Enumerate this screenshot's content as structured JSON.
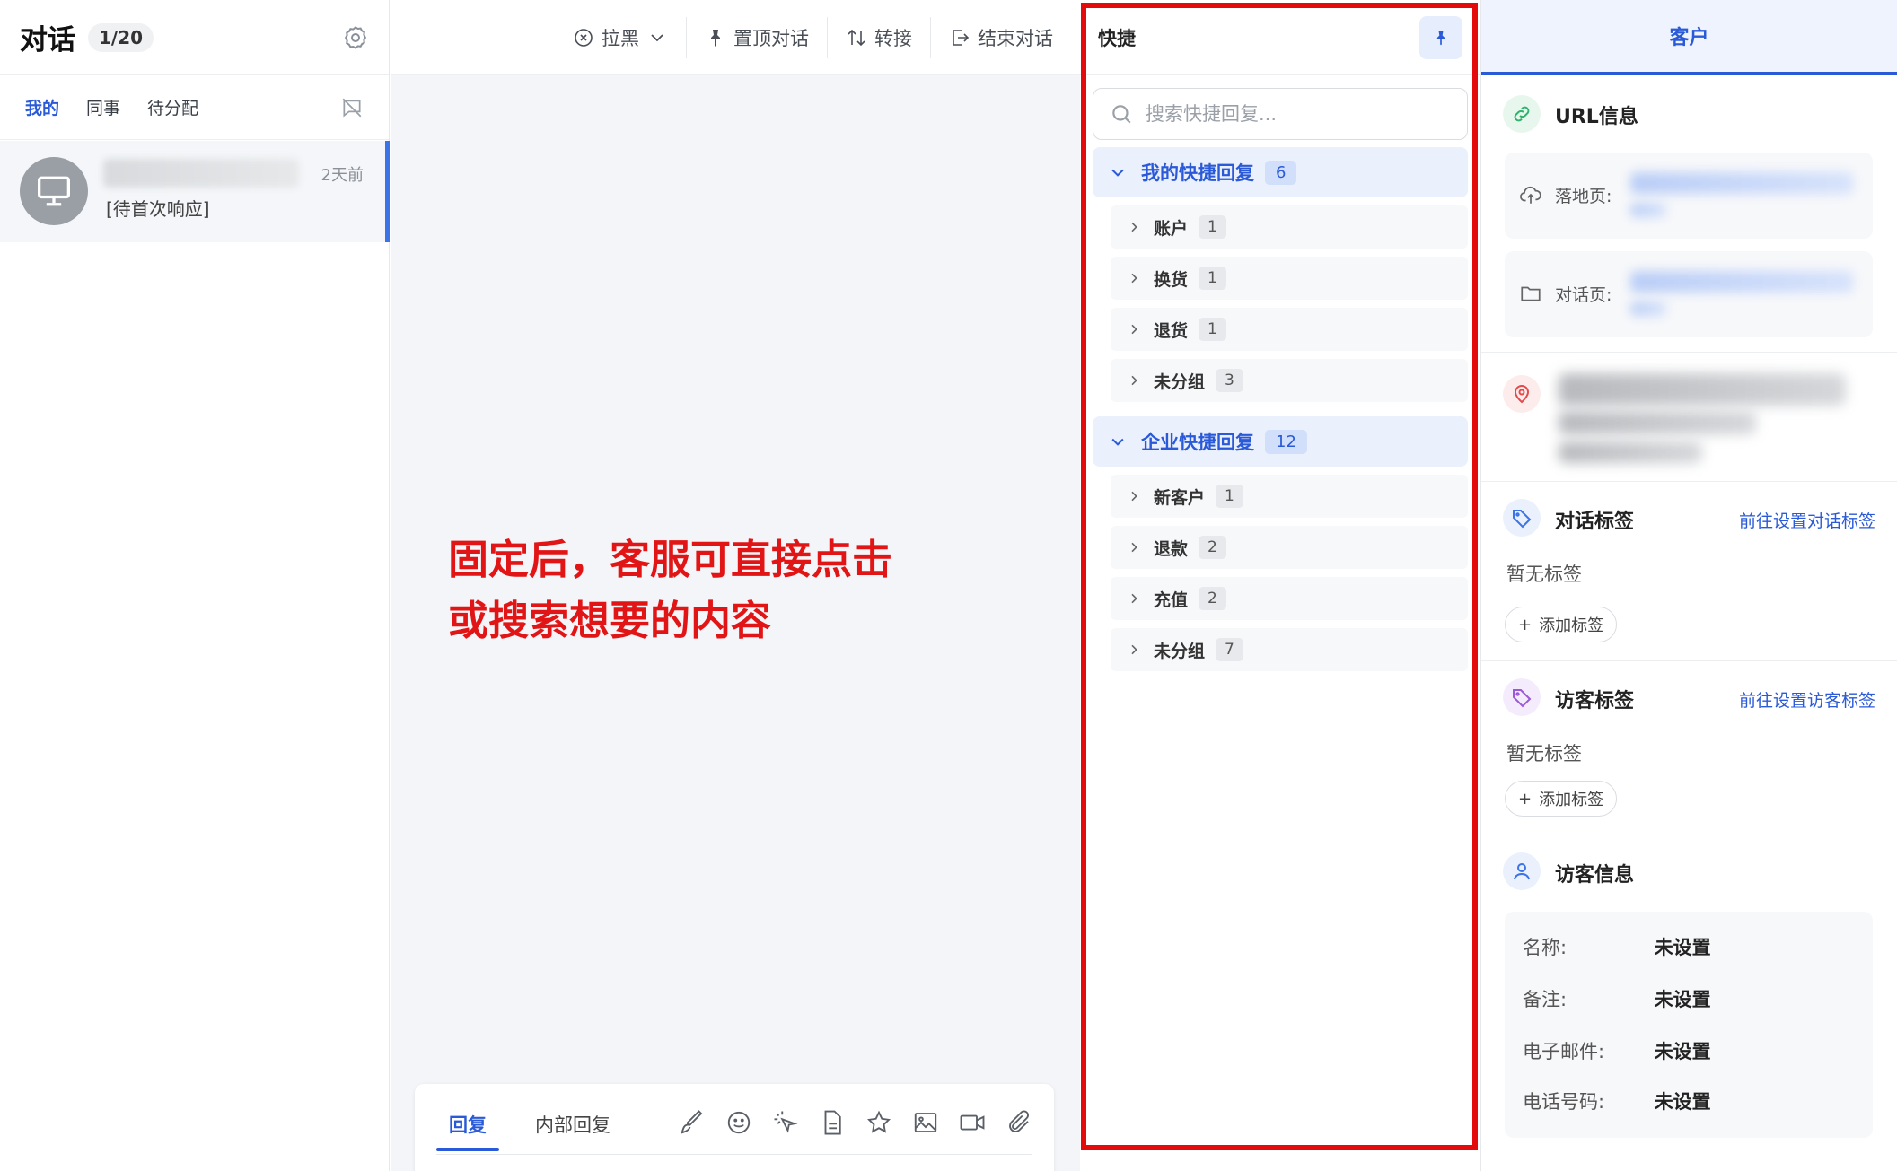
{
  "left": {
    "title": "对话",
    "count": "1/20",
    "tabs": [
      "我的",
      "同事",
      "待分配"
    ],
    "conversation": {
      "time": "2天前",
      "message": "[待首次响应]"
    }
  },
  "toolbar": {
    "blacklist": "拉黑",
    "pin": "置顶对话",
    "transfer": "转接",
    "end": "结束对话"
  },
  "annotation": {
    "line1": "固定后，客服可直接点击",
    "line2": "或搜索想要的内容"
  },
  "composer": {
    "tab_reply": "回复",
    "tab_internal": "内部回复"
  },
  "quick": {
    "title": "快捷",
    "search_placeholder": "搜索快捷回复...",
    "groups": [
      {
        "label": "我的快捷回复",
        "count": "6",
        "items": [
          {
            "label": "账户",
            "count": "1"
          },
          {
            "label": "换货",
            "count": "1"
          },
          {
            "label": "退货",
            "count": "1"
          },
          {
            "label": "未分组",
            "count": "3"
          }
        ]
      },
      {
        "label": "企业快捷回复",
        "count": "12",
        "items": [
          {
            "label": "新客户",
            "count": "1"
          },
          {
            "label": "退款",
            "count": "2"
          },
          {
            "label": "充值",
            "count": "2"
          },
          {
            "label": "未分组",
            "count": "7"
          }
        ]
      }
    ]
  },
  "right": {
    "tab": "客户",
    "url_section": {
      "title": "URL信息",
      "landing": "落地页:",
      "dialog": "对话页:"
    },
    "conv_tags": {
      "title": "对话标签",
      "link": "前往设置对话标签",
      "empty": "暂无标签",
      "add": "添加标签"
    },
    "visitor_tags": {
      "title": "访客标签",
      "link": "前往设置访客标签",
      "empty": "暂无标签",
      "add": "添加标签"
    },
    "visitor_info": {
      "title": "访客信息",
      "rows": [
        {
          "key": "名称:",
          "value": "未设置"
        },
        {
          "key": "备注:",
          "value": "未设置"
        },
        {
          "key": "电子邮件:",
          "value": "未设置"
        },
        {
          "key": "电话号码:",
          "value": "未设置"
        }
      ]
    }
  }
}
